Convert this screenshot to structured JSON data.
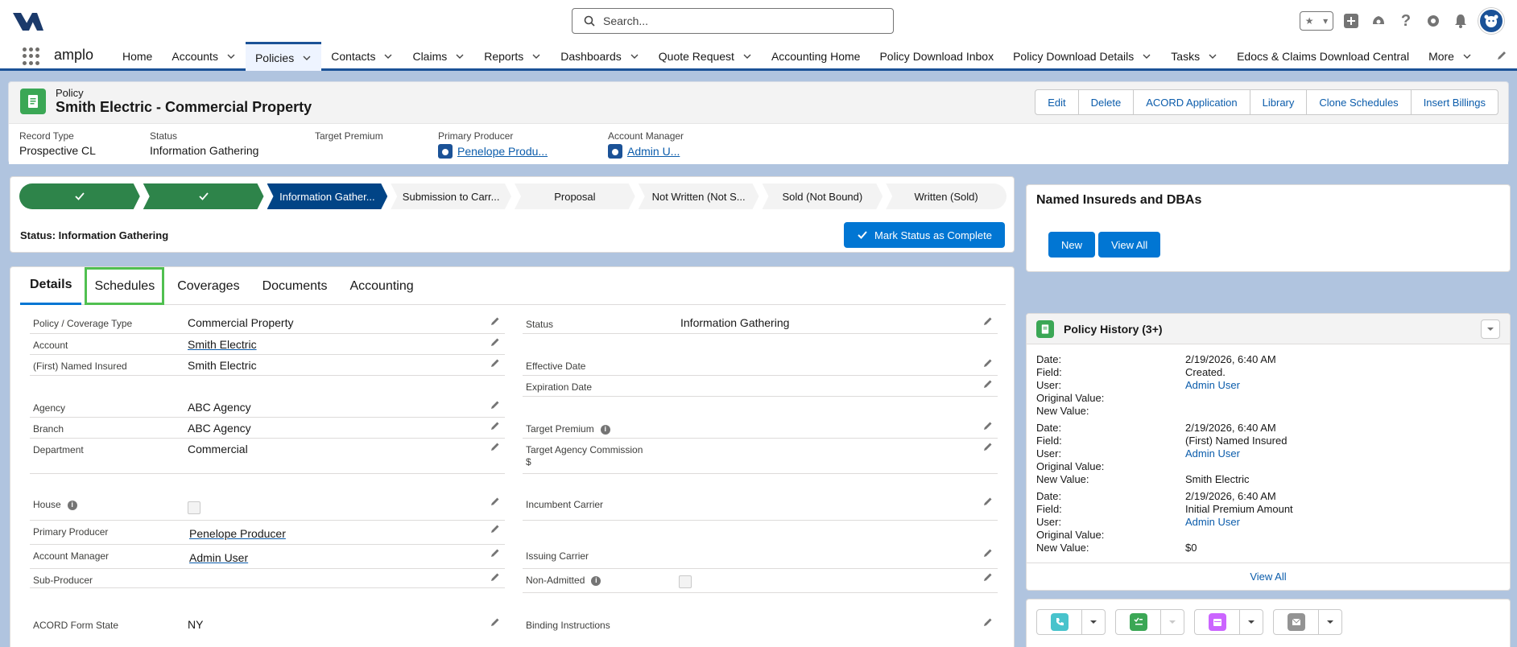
{
  "search": {
    "placeholder": "Search..."
  },
  "nav": {
    "app_name": "amplo",
    "items": [
      {
        "label": "Home",
        "chevron": false
      },
      {
        "label": "Accounts",
        "chevron": true
      },
      {
        "label": "Policies",
        "chevron": true,
        "active": true
      },
      {
        "label": "Contacts",
        "chevron": true
      },
      {
        "label": "Claims",
        "chevron": true
      },
      {
        "label": "Reports",
        "chevron": true
      },
      {
        "label": "Dashboards",
        "chevron": true
      },
      {
        "label": "Quote Request",
        "chevron": true
      },
      {
        "label": "Accounting Home",
        "chevron": false
      },
      {
        "label": "Policy Download Inbox",
        "chevron": false
      },
      {
        "label": "Policy Download Details",
        "chevron": true
      },
      {
        "label": "Tasks",
        "chevron": true
      },
      {
        "label": "Edocs & Claims Download Central",
        "chevron": false
      },
      {
        "label": "More",
        "chevron": true
      }
    ]
  },
  "record": {
    "object_label": "Policy",
    "title": "Smith Electric - Commercial Property",
    "actions": [
      "Edit",
      "Delete",
      "ACORD Application",
      "Library",
      "Clone Schedules",
      "Insert Billings"
    ],
    "highlights": {
      "record_type_label": "Record Type",
      "record_type": "Prospective CL",
      "status_label": "Status",
      "status": "Information Gathering",
      "target_premium_label": "Target Premium",
      "primary_producer_label": "Primary Producer",
      "primary_producer": "Penelope Produ...",
      "account_manager_label": "Account Manager",
      "account_manager": "Admin U..."
    }
  },
  "path": {
    "stages": [
      {
        "label": "",
        "state": "done"
      },
      {
        "label": "",
        "state": "done"
      },
      {
        "label": "Information Gather...",
        "state": "current"
      },
      {
        "label": "Submission to Carr...",
        "state": "todo"
      },
      {
        "label": "Proposal",
        "state": "todo"
      },
      {
        "label": "Not Written (Not S...",
        "state": "todo"
      },
      {
        "label": "Sold (Not Bound)",
        "state": "todo"
      },
      {
        "label": "Written (Sold)",
        "state": "todo"
      }
    ],
    "status_text": "Status: Information Gathering",
    "mark_complete": "Mark Status as Complete"
  },
  "tabs": [
    "Details",
    "Schedules",
    "Coverages",
    "Documents",
    "Accounting"
  ],
  "details": {
    "policy_coverage_type_label": "Policy / Coverage Type",
    "policy_coverage_type": "Commercial Property",
    "account_label": "Account",
    "account": "Smith Electric",
    "named_insured_label": "(First) Named Insured",
    "named_insured": "Smith Electric",
    "agency_label": "Agency",
    "agency": "ABC Agency",
    "branch_label": "Branch",
    "branch": "ABC Agency",
    "department_label": "Department",
    "department": "Commercial",
    "house_label": "House",
    "primary_producer_label": "Primary Producer",
    "primary_producer": "Penelope Producer",
    "account_manager_label": "Account Manager",
    "account_manager": "Admin User",
    "sub_producer_label": "Sub-Producer",
    "acord_form_state_label": "ACORD Form State",
    "acord_form_state": "NY",
    "status_label": "Status",
    "status": "Information Gathering",
    "effective_date_label": "Effective Date",
    "expiration_date_label": "Expiration Date",
    "target_premium_label": "Target Premium",
    "target_agency_commission_label": "Target Agency Commission",
    "target_agency_commission_unit": "$",
    "incumbent_carrier_label": "Incumbent Carrier",
    "issuing_carrier_label": "Issuing Carrier",
    "non_admitted_label": "Non-Admitted",
    "binding_instructions_label": "Binding Instructions"
  },
  "named_insureds": {
    "title": "Named Insureds and DBAs",
    "new": "New",
    "view_all": "View All"
  },
  "history": {
    "title": "Policy History (3+)",
    "keys": {
      "date": "Date:",
      "field": "Field:",
      "user": "User:",
      "orig": "Original Value:",
      "new": "New Value:"
    },
    "entries": [
      {
        "date": "2/19/2026, 6:40 AM",
        "field": "Created.",
        "user": "Admin User",
        "orig": "",
        "new": ""
      },
      {
        "date": "2/19/2026, 6:40 AM",
        "field": "(First) Named Insured",
        "user": "Admin User",
        "orig": "",
        "new": "Smith Electric"
      },
      {
        "date": "2/19/2026, 6:40 AM",
        "field": "Initial Premium Amount",
        "user": "Admin User",
        "orig": "",
        "new": "$0"
      }
    ],
    "view_all": "View All"
  },
  "colors": {
    "brand": "#1b5297",
    "path_done": "#2e844a",
    "path_current": "#014486",
    "button": "#0176d3",
    "policy_icon": "#3ba755"
  }
}
